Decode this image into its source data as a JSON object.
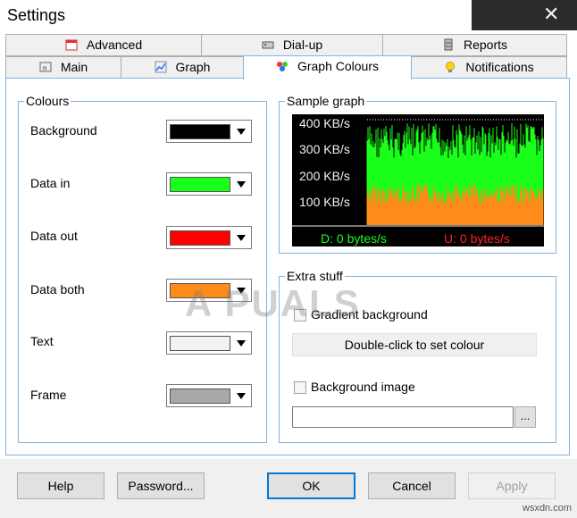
{
  "window": {
    "title": "Settings",
    "close_glyph": "✕"
  },
  "tabs_row1": [
    {
      "label": "Advanced",
      "icon": "calendar-icon"
    },
    {
      "label": "Dial-up",
      "icon": "modem-icon"
    },
    {
      "label": "Reports",
      "icon": "server-icon"
    }
  ],
  "tabs_row2": [
    {
      "label": "Main",
      "icon": "window-icon"
    },
    {
      "label": "Graph",
      "icon": "graph-icon"
    },
    {
      "label": "Graph Colours",
      "icon": "palette-icon",
      "active": true
    },
    {
      "label": "Notifications",
      "icon": "bulb-icon"
    }
  ],
  "colours": {
    "title": "Colours",
    "items": [
      {
        "label": "Background",
        "color": "#000000"
      },
      {
        "label": "Data in",
        "color": "#1aff1a"
      },
      {
        "label": "Data out",
        "color": "#ff0000"
      },
      {
        "label": "Data both",
        "color": "#ff8c1a"
      },
      {
        "label": "Text",
        "color": "#f2f2f2"
      },
      {
        "label": "Frame",
        "color": "#a8a8a8"
      }
    ]
  },
  "sample": {
    "title": "Sample graph",
    "ylabels": [
      "400 KB/s",
      "300 KB/s",
      "200 KB/s",
      "100 KB/s"
    ],
    "down": "D: 0 bytes/s",
    "up": "U: 0 bytes/s",
    "colors": {
      "in": "#1aff1a",
      "out": "#ff8c1a",
      "down_text": "#1aff1a",
      "up_text": "#ff2222"
    }
  },
  "extra": {
    "title": "Extra stuff",
    "gradient_label": "Gradient background",
    "gradient_checked": false,
    "set_colour_label": "Double-click to set colour",
    "bgimage_label": "Background image",
    "bgimage_checked": false,
    "path_value": "",
    "browse_label": "..."
  },
  "buttons": {
    "help": "Help",
    "password": "Password...",
    "ok": "OK",
    "cancel": "Cancel",
    "apply": "Apply"
  },
  "watermark": {
    "text": "A  PUALS",
    "site": "wsxdn.com"
  }
}
